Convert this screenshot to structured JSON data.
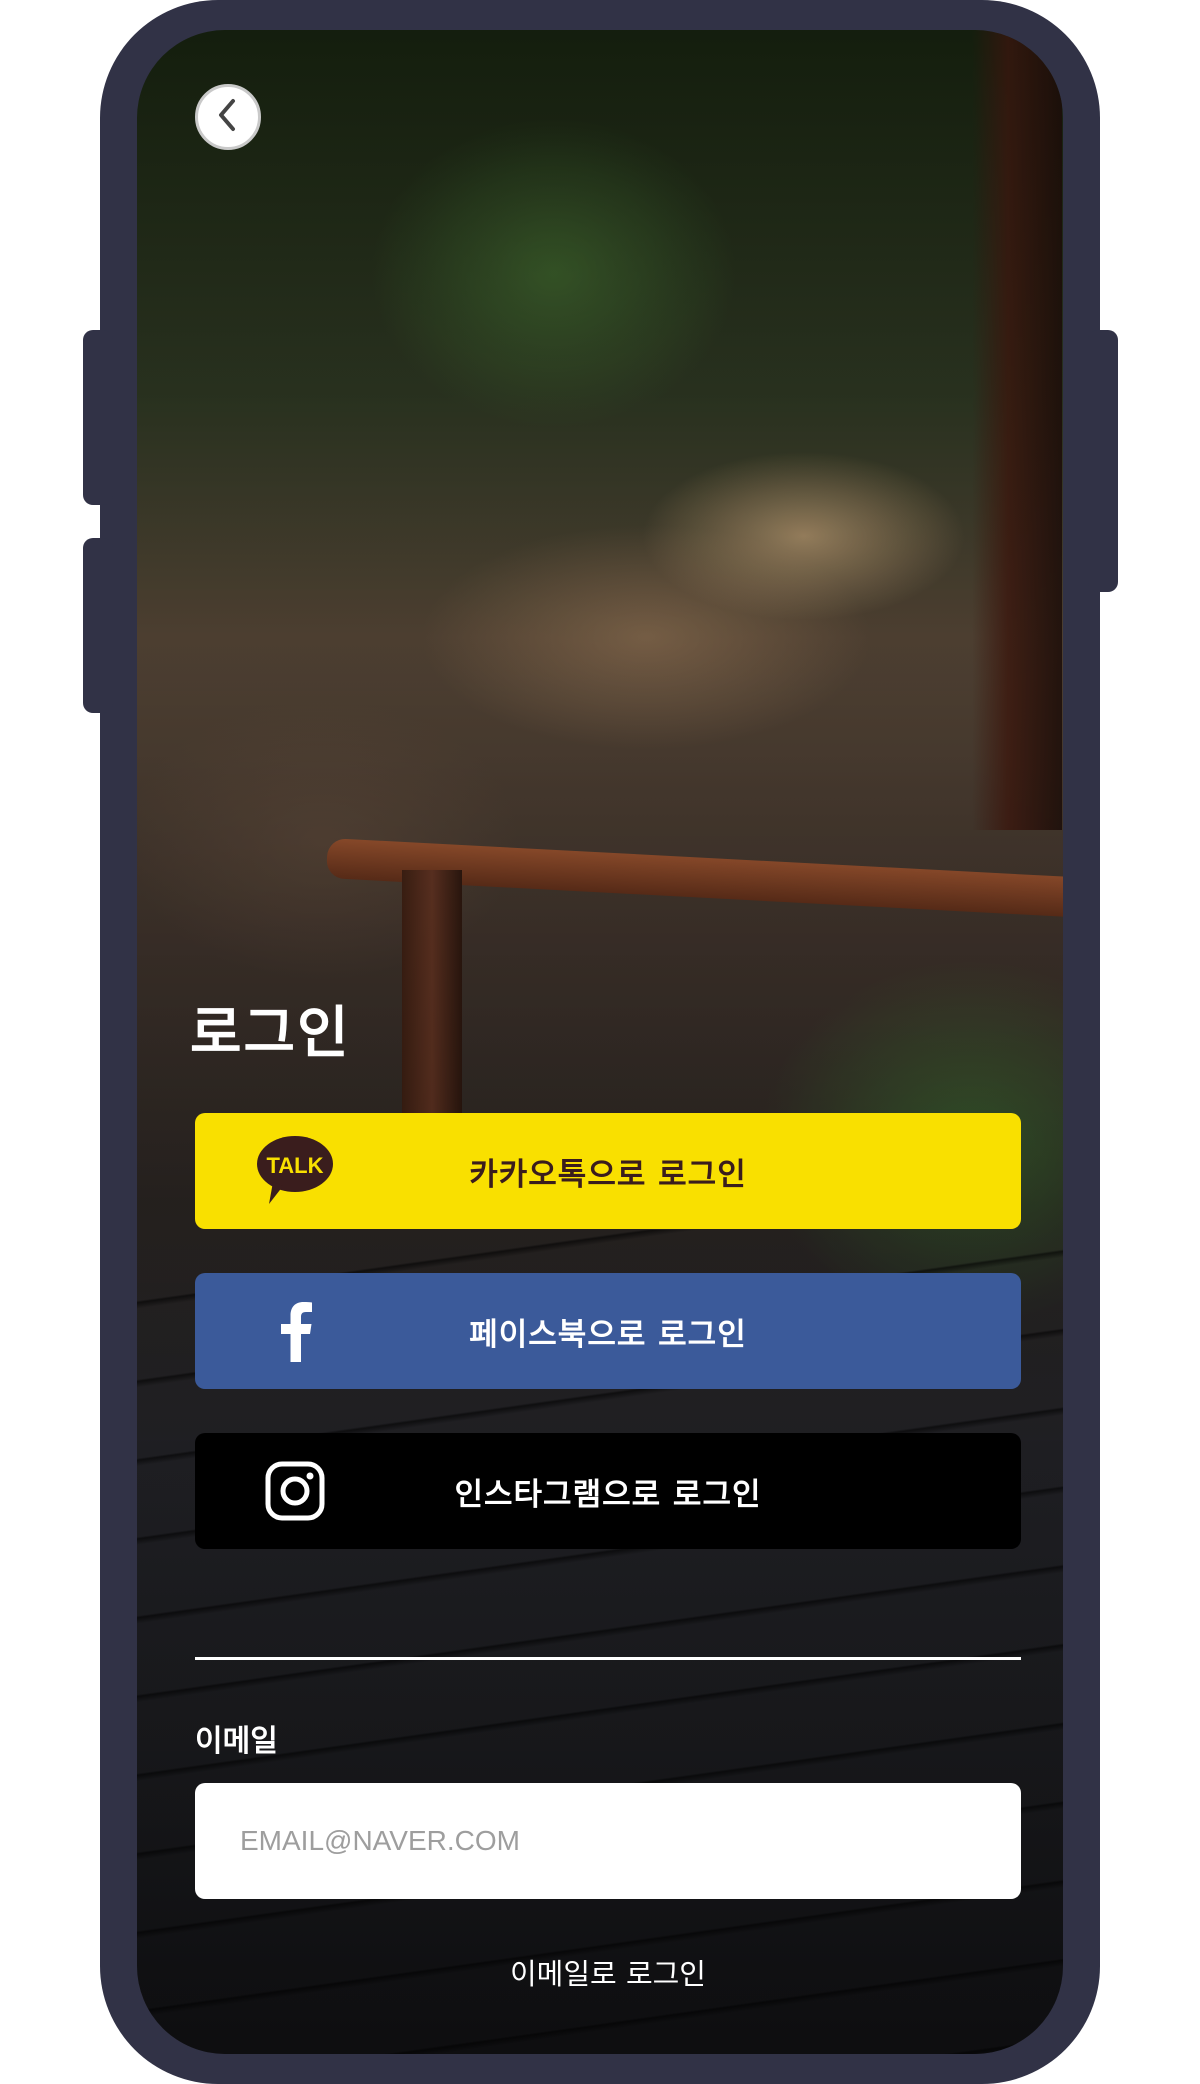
{
  "screen": {
    "title": "로그인"
  },
  "buttons": {
    "kakao": {
      "label": "카카오톡으로 로그인",
      "icon": "kakao-talk-icon",
      "icon_text": "TALK",
      "color": "#f9e000"
    },
    "facebook": {
      "label": "페이스북으로 로그인",
      "icon": "facebook-icon",
      "color": "#3b5a9a"
    },
    "instagram": {
      "label": "인스타그램으로 로그인",
      "icon": "instagram-icon",
      "color": "#000000"
    }
  },
  "email": {
    "label": "이메일",
    "placeholder": "EMAIL@NAVER.COM",
    "value": ""
  },
  "email_login": {
    "label": "이메일로 로그인"
  },
  "icons": {
    "back": "chevron-left-icon"
  }
}
